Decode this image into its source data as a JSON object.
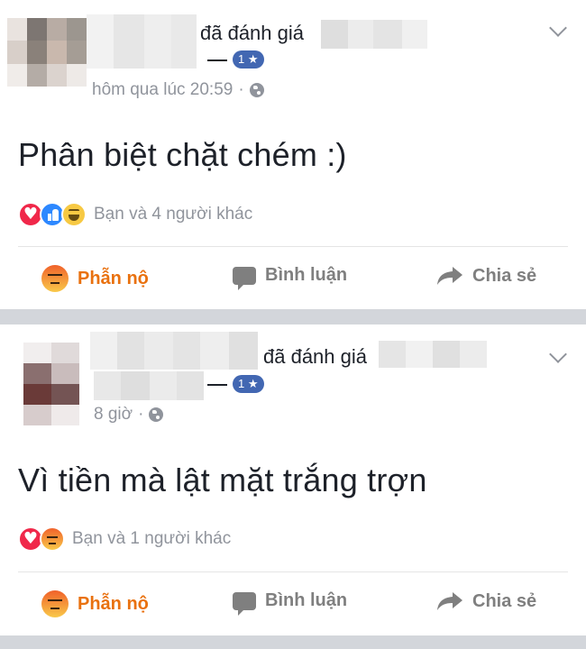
{
  "colors": {
    "background": "#ffffff",
    "separator": "#d3d6db",
    "primary_text": "#1d2129",
    "secondary_text": "#90949c",
    "action_text": "#7f7f7f",
    "angry_active": "#e9710f",
    "badge": "#4267b2"
  },
  "posts": [
    {
      "action_text": "đã đánh giá",
      "rating_badge": "1 ★",
      "timestamp": "hôm qua lúc 20:59",
      "privacy_icon": "globe-icon",
      "menu_icon": "chevron-down-icon",
      "body": "Phân biệt chặt chém :)",
      "reactions": [
        "love",
        "like",
        "haha"
      ],
      "reaction_summary": "Bạn và 4 người khác",
      "actions": {
        "react": "Phẫn nộ",
        "comment": "Bình luận",
        "share": "Chia sẻ"
      }
    },
    {
      "action_text": "đã đánh giá",
      "rating_badge": "1 ★",
      "timestamp": "8 giờ",
      "privacy_icon": "globe-icon",
      "menu_icon": "chevron-down-icon",
      "body": "Vì tiền mà lật mặt trắng trợn",
      "reactions": [
        "love",
        "angry"
      ],
      "reaction_summary": "Bạn và 1 người khác",
      "actions": {
        "react": "Phẫn nộ",
        "comment": "Bình luận",
        "share": "Chia sẻ"
      }
    }
  ]
}
